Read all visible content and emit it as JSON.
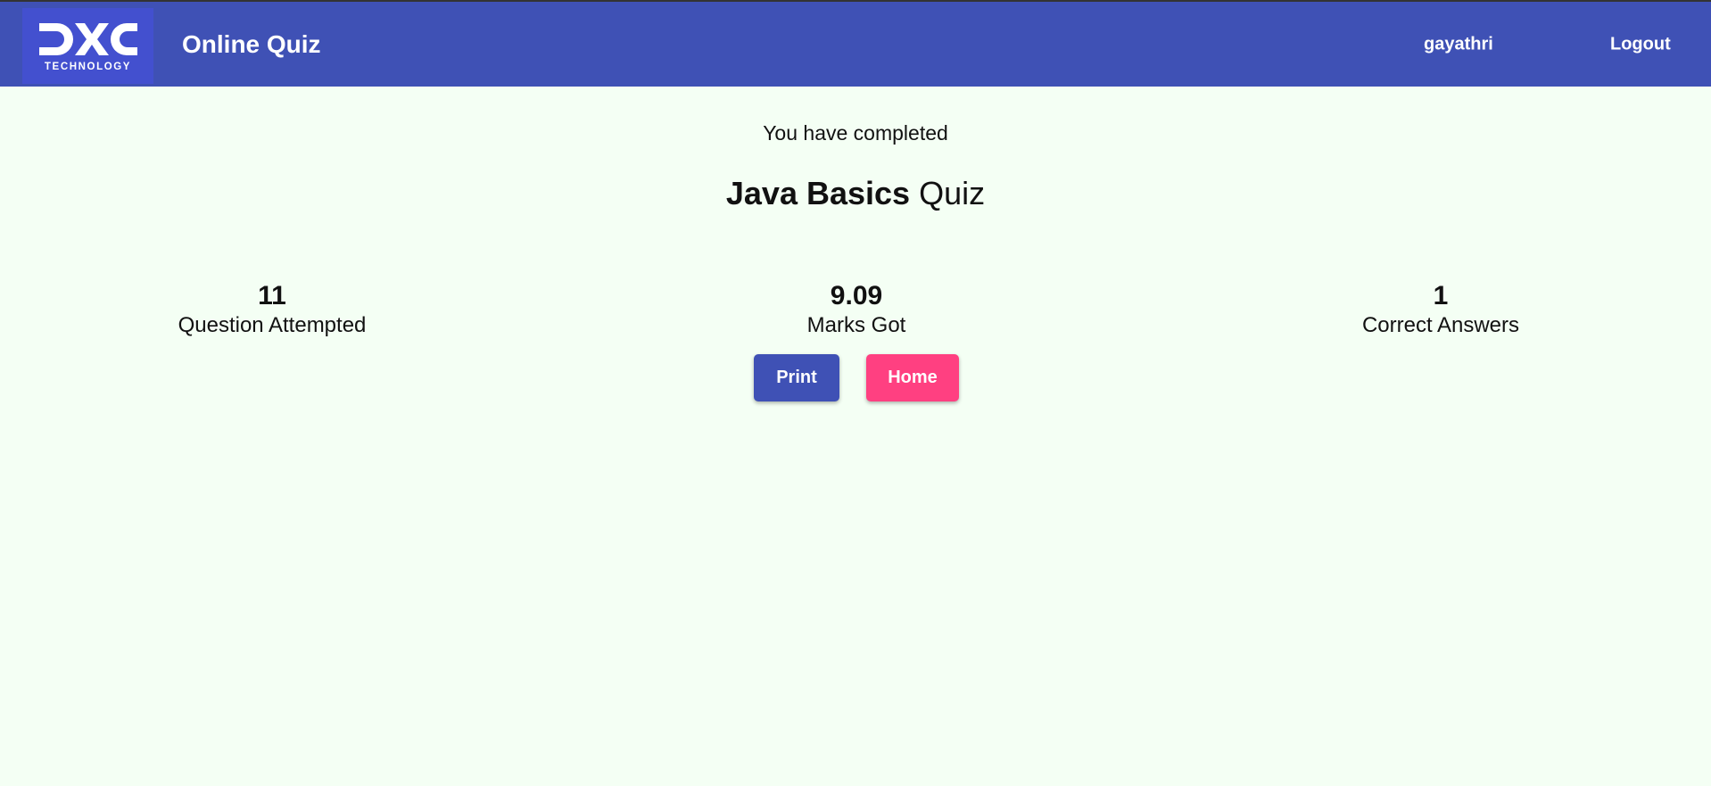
{
  "header": {
    "logo_text": "DXC",
    "logo_subtext": "TECHNOLOGY",
    "app_title": "Online Quiz",
    "username": "gayathri",
    "logout_label": "Logout"
  },
  "result": {
    "completed_text": "You have completed",
    "quiz_name": "Java Basics",
    "quiz_suffix": "Quiz"
  },
  "stats": {
    "attempted": {
      "value": "11",
      "label": "Question Attempted"
    },
    "marks": {
      "value": "9.09",
      "label": "Marks Got"
    },
    "correct": {
      "value": "1",
      "label": "Correct Answers"
    }
  },
  "actions": {
    "print_label": "Print",
    "home_label": "Home"
  },
  "colors": {
    "header_bg": "#3f51b5",
    "logo_bg": "#4350cf",
    "page_bg": "#f4fff4",
    "print_button": "#3f51b5",
    "home_button": "#ff4081"
  },
  "icons": {
    "logo": "dxc-logo-icon"
  }
}
